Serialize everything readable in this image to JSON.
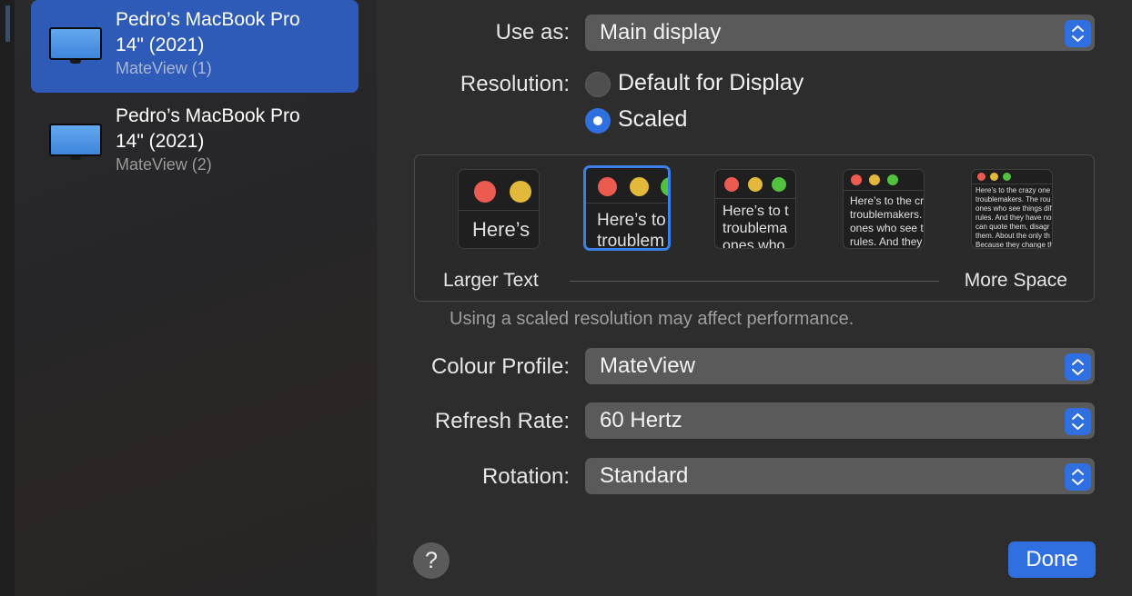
{
  "sidebar": {
    "devices": [
      {
        "name": "Pedro’s MacBook Pro\n14\" (2021)",
        "subtitle": "MateView (1)",
        "selected": true
      },
      {
        "name": "Pedro’s MacBook Pro\n14\" (2021)",
        "subtitle": "MateView (2)",
        "selected": false
      }
    ]
  },
  "settings": {
    "use_as": {
      "label": "Use as:",
      "value": "Main display"
    },
    "resolution": {
      "label": "Resolution:",
      "options": [
        {
          "label": "Default for Display",
          "selected": false
        },
        {
          "label": "Scaled",
          "selected": true
        }
      ]
    },
    "scale": {
      "thumbnails": [
        {
          "text": "Here’s",
          "selected": false
        },
        {
          "text": "Here’s to\ntroublem",
          "selected": true
        },
        {
          "text": "Here’s to t\ntroublema\nones who",
          "selected": false
        },
        {
          "text": "Here’s to the cr\ntroublemakers.\nones who see t\nrules. And they",
          "selected": false
        },
        {
          "text": "Here’s to the crazy one\ntroublemakers. The rou\nones who see things dif\nrules. And they have no\ncan quote them, disagr\nthem. About the only th\nBecause they change th",
          "selected": false
        }
      ],
      "left_label": "Larger Text",
      "right_label": "More Space",
      "note": "Using a scaled resolution may affect performance."
    },
    "colour_profile": {
      "label": "Colour Profile:",
      "value": "MateView"
    },
    "refresh_rate": {
      "label": "Refresh Rate:",
      "value": "60 Hertz"
    },
    "rotation": {
      "label": "Rotation:",
      "value": "Standard"
    }
  },
  "footer": {
    "help_label": "?",
    "done_label": "Done"
  },
  "colors": {
    "accent": "#2f6fe0",
    "selection": "#2e5bb7",
    "traffic_red": "#ec5b50",
    "traffic_yellow": "#e3b93b",
    "traffic_green": "#52c13d"
  }
}
